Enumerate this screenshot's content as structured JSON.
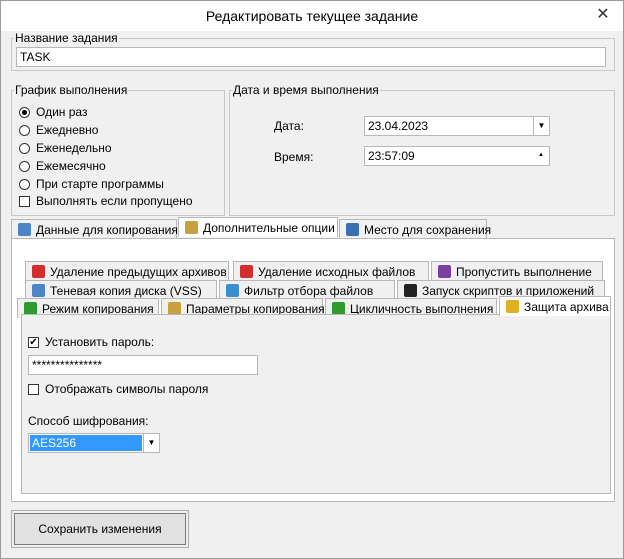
{
  "window": {
    "title": "Редактировать текущее задание",
    "close_glyph": "✕"
  },
  "task_name": {
    "legend": "Название задания",
    "value": "TASK"
  },
  "schedule": {
    "legend": "График выполнения",
    "options": [
      "Один раз",
      "Ежедневно",
      "Еженедельно",
      "Ежемесячно",
      "При старте программы"
    ],
    "selected_index": 0,
    "run_if_missed_label": "Выполнять если пропущено",
    "run_if_missed": false
  },
  "datetime": {
    "legend": "Дата и время выполнения",
    "date_label": "Дата:",
    "date_value": "23.04.2023",
    "time_label": "Время:",
    "time_value": "23:57:09"
  },
  "main_tabs": [
    {
      "label": "Данные для копирования",
      "icon": "data-icon"
    },
    {
      "label": "Дополнительные опции",
      "icon": "options-icon"
    },
    {
      "label": "Место для сохранения",
      "icon": "save-location-icon"
    }
  ],
  "sub_tabs": {
    "row1": [
      {
        "label": "Удаление предыдущих архивов",
        "icon": "delete-archives-icon"
      },
      {
        "label": "Удаление исходных файлов",
        "icon": "delete-source-icon"
      },
      {
        "label": "Пропустить выполнение",
        "icon": "skip-icon"
      }
    ],
    "row2": [
      {
        "label": "Теневая копия диска (VSS)",
        "icon": "shadow-copy-icon"
      },
      {
        "label": "Фильтр отбора файлов",
        "icon": "filter-icon"
      },
      {
        "label": "Запуск скриптов и приложений",
        "icon": "script-icon"
      }
    ],
    "row3": [
      {
        "label": "Режим копирования",
        "icon": "copy-mode-icon"
      },
      {
        "label": "Параметры копирования",
        "icon": "copy-params-icon"
      },
      {
        "label": "Цикличность выполнения",
        "icon": "cycle-icon"
      },
      {
        "label": "Защита архива",
        "icon": "lock-icon"
      }
    ]
  },
  "protection": {
    "set_password_label": "Установить пароль:",
    "set_password": true,
    "password_value": "***************",
    "show_password_label": "Отображать символы пароля",
    "show_password": false,
    "encryption_label": "Способ шифрования:",
    "encryption_value": "AES256"
  },
  "save_button_label": "Сохранить изменения",
  "colors": {
    "selection": "#3399ff",
    "accent_green": "#2e9b2e",
    "accent_red": "#d32f2f"
  }
}
